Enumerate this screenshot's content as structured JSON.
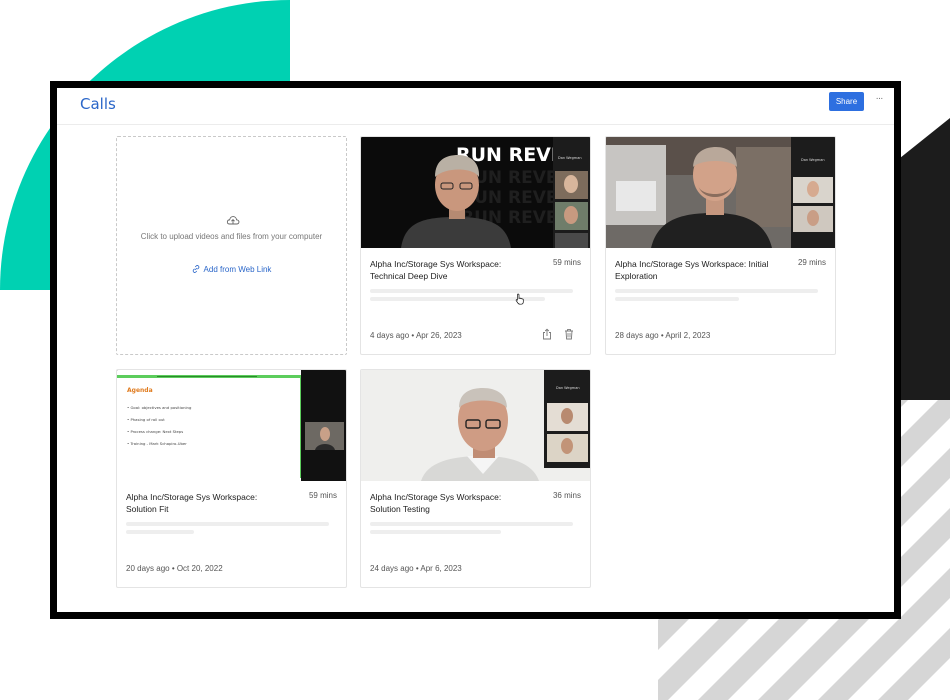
{
  "header": {
    "title": "Calls",
    "share_label": "Share",
    "more_label": "···"
  },
  "upload": {
    "instruction": "Click to upload videos and files from your computer",
    "web_link_label": "Add from Web Link"
  },
  "calls": [
    {
      "title": "Alpha Inc/Storage Sys Workspace: Technical Deep Dive",
      "duration": "59 mins",
      "date": "4 days ago • Apr 26, 2023",
      "thumb_banner": "RUN REVE",
      "thumb_caption": "Dan Wegman"
    },
    {
      "title": "Alpha Inc/Storage Sys Workspace: Initial Exploration",
      "duration": "29 mins",
      "date": "28 days ago • April 2, 2023",
      "thumb_caption": "Dan Wegman"
    },
    {
      "title": "Alpha Inc/Storage Sys Workspace: Solution Fit",
      "duration": "59 mins",
      "date": "20 days ago • Oct 20, 2022",
      "slide_heading": "Agenda",
      "slide_bullets": [
        "Goal: objectives and positioning",
        "Phasing of roll out",
        "Process change: Next Steps",
        "Training - Mark Schapiro-Uber"
      ]
    },
    {
      "title": "Alpha Inc/Storage Sys Workspace: Solution Testing",
      "duration": "36 mins",
      "date": "24 days ago • Apr 6, 2023",
      "thumb_caption": "Dan Wegman"
    }
  ],
  "colors": {
    "accent": "#2d6fe0",
    "link": "#2a66c9",
    "teal_decoration": "#00d1b2"
  }
}
